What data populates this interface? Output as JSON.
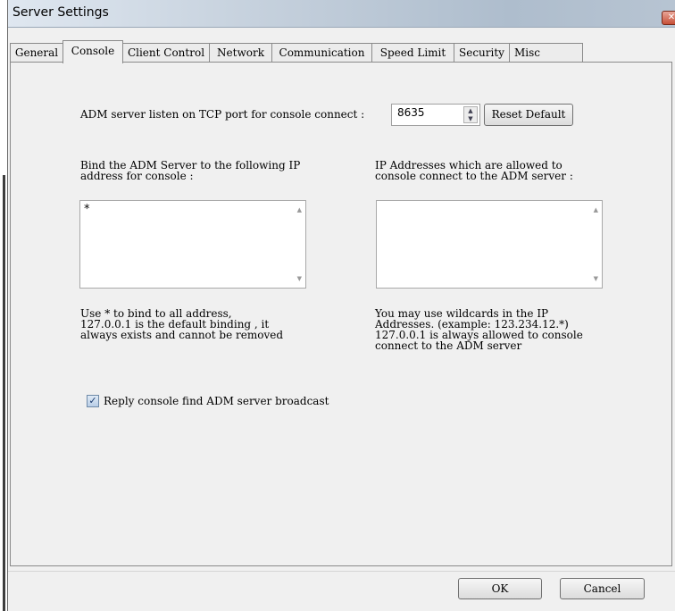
{
  "window": {
    "title": "Server Settings"
  },
  "tabs": [
    {
      "label": "General"
    },
    {
      "label": "Console"
    },
    {
      "label": "Client Control"
    },
    {
      "label": "Network"
    },
    {
      "label": "Communication"
    },
    {
      "label": "Speed Limit"
    },
    {
      "label": "Security"
    },
    {
      "label": "Misc"
    }
  ],
  "active_tab": "Console",
  "console": {
    "port_label": "ADM server listen on TCP port for console connect :",
    "port_value": "8635",
    "reset_default_label": "Reset Default",
    "bind_label_line1": "Bind the ADM Server to the following IP",
    "bind_label_line2": "address for console :",
    "bind_list_content": "*",
    "allowed_label_line1": "IP Addresses which are allowed to",
    "allowed_label_line2": "console connect to the ADM server :",
    "allowed_list_content": "",
    "bind_help": [
      "Use * to bind to all address,",
      "127.0.0.1 is the default binding , it",
      "always exists and cannot be removed"
    ],
    "allowed_help": [
      "You may use wildcards in the IP",
      "Addresses. (example: 123.234.12.*)",
      "127.0.0.1 is always allowed to console",
      "connect to the ADM server"
    ],
    "reply_broadcast_label": "Reply console find ADM server broadcast",
    "reply_broadcast_checked": true
  },
  "footer": {
    "ok_label": "OK",
    "cancel_label": "Cancel"
  },
  "icons": {
    "close": "close-icon",
    "spin_up": "spin-up-icon",
    "spin_down": "spin-down-icon",
    "check": "checkmark-icon"
  }
}
